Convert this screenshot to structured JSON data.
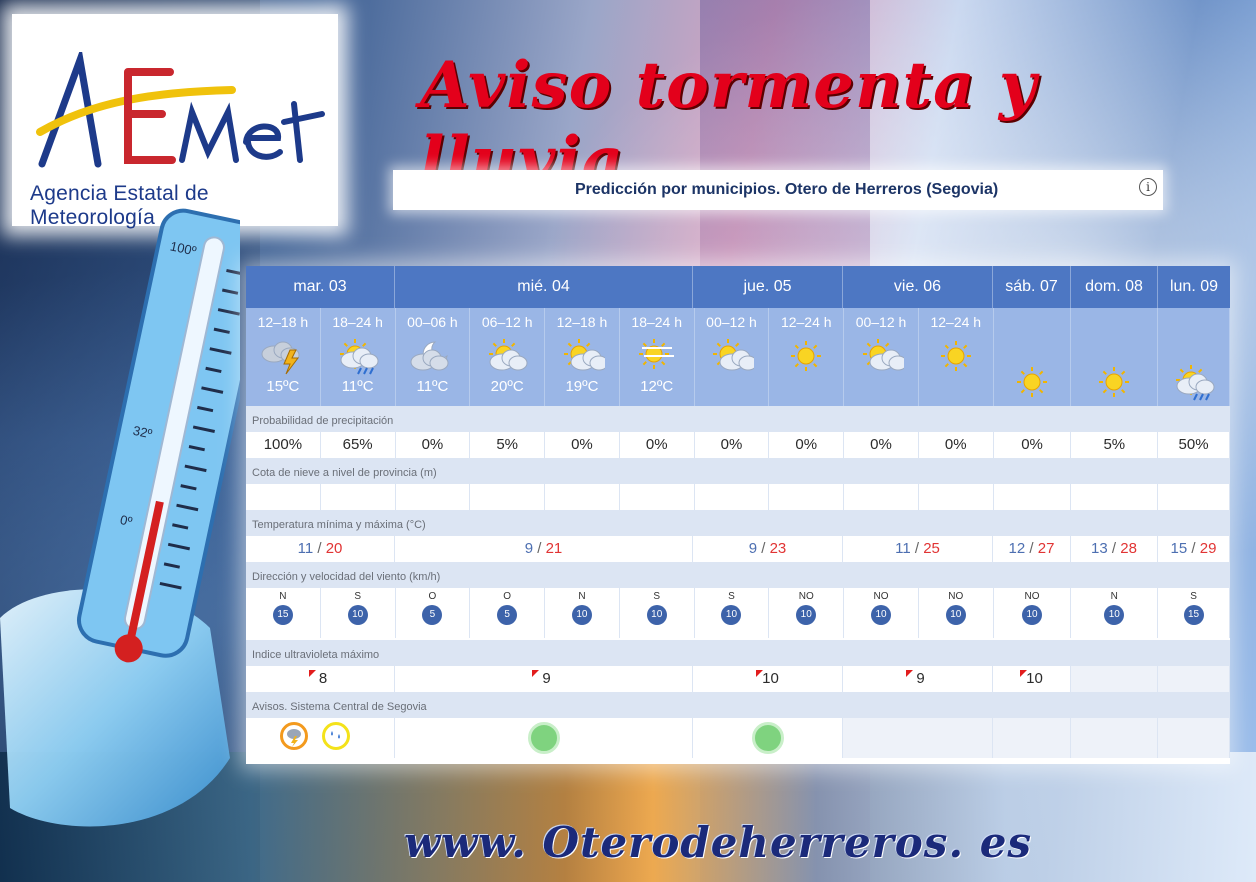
{
  "logo": {
    "brand": "AEmet",
    "subtitle": "Agencia Estatal de Meteorología"
  },
  "title": "Aviso tormenta y lluvia",
  "subheader": "Predicción por municipios. Otero de Herreros (Segovia)",
  "info_icon": "info-icon",
  "days": [
    {
      "label": "mar. 03"
    },
    {
      "label": "mié. 04"
    },
    {
      "label": "jue. 05"
    },
    {
      "label": "vie. 06"
    },
    {
      "label": "sáb. 07"
    },
    {
      "label": "dom. 08"
    },
    {
      "label": "lun. 09"
    }
  ],
  "periods": [
    {
      "hours": "12–18 h",
      "icon": "storm-cloud-icon",
      "temp": "15ºC"
    },
    {
      "hours": "18–24 h",
      "icon": "sun-cloud-rain-icon",
      "temp": "11ºC"
    },
    {
      "hours": "00–06 h",
      "icon": "moon-cloud-icon",
      "temp": "11ºC"
    },
    {
      "hours": "06–12 h",
      "icon": "sun-cloud-icon",
      "temp": "20ºC"
    },
    {
      "hours": "12–18 h",
      "icon": "sun-small-cloud-icon",
      "temp": "19ºC"
    },
    {
      "hours": "18–24 h",
      "icon": "sun-haze-icon",
      "temp": "12ºC"
    },
    {
      "hours": "00–12 h",
      "icon": "sun-small-cloud-icon",
      "temp": ""
    },
    {
      "hours": "12–24 h",
      "icon": "sun-icon",
      "temp": ""
    },
    {
      "hours": "00–12 h",
      "icon": "sun-small-cloud-icon",
      "temp": ""
    },
    {
      "hours": "12–24 h",
      "icon": "sun-icon",
      "temp": ""
    },
    {
      "hours": "",
      "icon": "sun-icon",
      "temp": ""
    },
    {
      "hours": "",
      "icon": "sun-icon",
      "temp": ""
    },
    {
      "hours": "",
      "icon": "sun-cloud-rain-icon",
      "temp": ""
    }
  ],
  "sections": {
    "precip": "Probabilidad de precipitación",
    "snow": "Cota de nieve a nivel de provincia (m)",
    "temp": "Temperatura mínima y máxima (°C)",
    "wind": "Dirección y velocidad del viento (km/h)",
    "uv": "Indice ultravioleta máximo",
    "avisos": "Avisos. Sistema Central de Segovia"
  },
  "precip": [
    "100%",
    "65%",
    "0%",
    "5%",
    "0%",
    "0%",
    "0%",
    "0%",
    "0%",
    "0%",
    "0%",
    "5%",
    "50%"
  ],
  "temps": [
    {
      "min": "11",
      "sep": " / ",
      "max": "20"
    },
    {
      "min": "9",
      "sep": " / ",
      "max": "21"
    },
    {
      "min": "9",
      "sep": " / ",
      "max": "23"
    },
    {
      "min": "11",
      "sep": " / ",
      "max": "25"
    },
    {
      "min": "12",
      "sep": " / ",
      "max": "27"
    },
    {
      "min": "13",
      "sep": " / ",
      "max": "28"
    },
    {
      "min": "15",
      "sep": " / ",
      "max": "29"
    }
  ],
  "wind": [
    {
      "dir": "N",
      "speed": "15"
    },
    {
      "dir": "S",
      "speed": "10"
    },
    {
      "dir": "O",
      "speed": "5"
    },
    {
      "dir": "O",
      "speed": "5"
    },
    {
      "dir": "N",
      "speed": "10"
    },
    {
      "dir": "S",
      "speed": "10"
    },
    {
      "dir": "S",
      "speed": "10"
    },
    {
      "dir": "NO",
      "speed": "10"
    },
    {
      "dir": "NO",
      "speed": "10"
    },
    {
      "dir": "NO",
      "speed": "10"
    },
    {
      "dir": "NO",
      "speed": "10"
    },
    {
      "dir": "N",
      "speed": "10"
    },
    {
      "dir": "S",
      "speed": "15"
    }
  ],
  "uv": [
    "8",
    "9",
    "10",
    "9",
    "10"
  ],
  "avisos": {
    "storm": {
      "icon": "storm-warning-icon",
      "color": "#f39a1e"
    },
    "rain": {
      "icon": "rain-warning-icon",
      "color": "#f4e21a"
    },
    "green": "#7fd37f"
  },
  "thermometer": {
    "marks": [
      "100º",
      "32º",
      "0º"
    ]
  },
  "footer": "www. Oterodeherreros. es"
}
